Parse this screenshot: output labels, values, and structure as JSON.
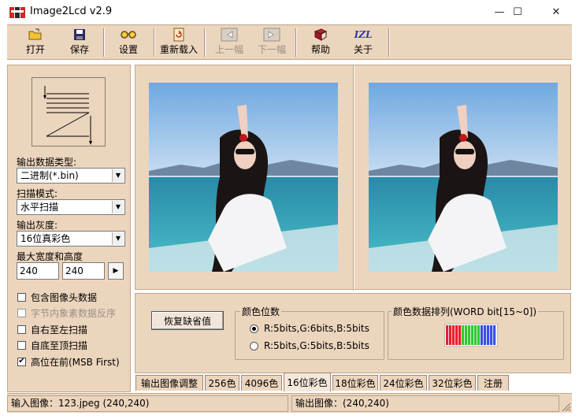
{
  "window": {
    "title": "Image2Lcd v2.9",
    "minimize_glyph": "—",
    "maximize_glyph": "☐",
    "close_glyph": "✕"
  },
  "toolbar": {
    "open": "打开",
    "save": "保存",
    "settings": "设置",
    "reload": "重新载入",
    "prev": "上一幅",
    "next": "下一幅",
    "help": "帮助",
    "about": "关于",
    "about_icon_text": "IZL"
  },
  "left": {
    "output_type_label": "输出数据类型:",
    "output_type_value": "二进制(*.bin)",
    "scan_mode_label": "扫描模式:",
    "scan_mode_value": "水平扫描",
    "gray_label": "输出灰度:",
    "gray_value": "16位真彩色",
    "size_label": "最大宽度和高度",
    "width_value": "240",
    "height_value": "240",
    "size_arrow": "▶",
    "checkboxes": [
      {
        "label": "包含图像头数据",
        "checked": false,
        "enabled": true
      },
      {
        "label": "字节内象素数据反序",
        "checked": false,
        "enabled": false
      },
      {
        "label": "自右至左扫描",
        "checked": false,
        "enabled": true
      },
      {
        "label": "自底至顶扫描",
        "checked": false,
        "enabled": true
      },
      {
        "label": "高位在前(MSB First)",
        "checked": true,
        "enabled": true
      }
    ]
  },
  "bottom": {
    "restore_button": "恢复缺省值",
    "color_bits_title": "颜色位数",
    "radio1": "R:5bits,G:6bits,B:5bits",
    "radio2": "R:5bits,G:5bits,B:5bits",
    "radio_selected": 1,
    "arrange_title": "颜色数据排列(WORD bit[15~0])"
  },
  "tabs": [
    "输出图像调整",
    "256色",
    "4096色",
    "16位彩色",
    "18位彩色",
    "24位彩色",
    "32位彩色",
    "注册"
  ],
  "active_tab": 3,
  "status": {
    "input": "输入图像：123.jpeg (240,240)",
    "output": "输出图像：(240,240)"
  },
  "colors": {
    "panel_bg": "#ecd5bd",
    "bit_red": "#e8202a",
    "bit_green": "#32c832",
    "bit_blue": "#3c50e6"
  }
}
